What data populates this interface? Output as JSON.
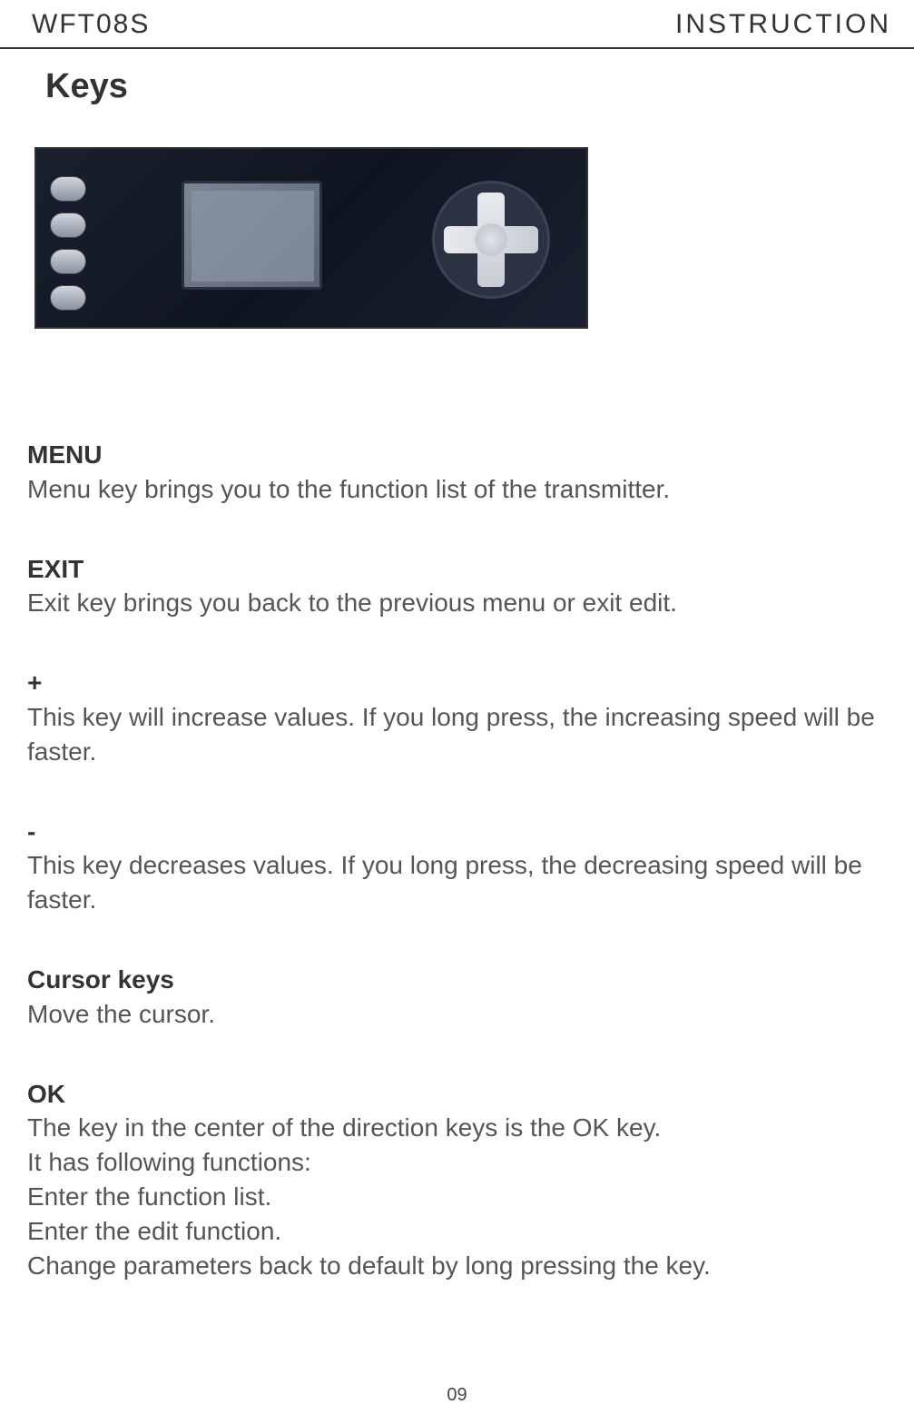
{
  "header": {
    "left": "WFT08S",
    "right": "INSTRUCTION"
  },
  "title": "Keys",
  "sections": {
    "menu": {
      "title": "MENU",
      "body": "Menu key brings you to the function list of the transmitter."
    },
    "exit": {
      "title": "EXIT",
      "body": "Exit key brings you back to the previous menu or exit edit."
    },
    "plus": {
      "title": "+",
      "body": "This key will increase values. If you long press, the increasing speed will be faster."
    },
    "minus": {
      "title": "-",
      "body": "This key decreases values. If you long press, the decreasing speed will be faster."
    },
    "cursor": {
      "title": "Cursor keys",
      "body": "Move the cursor."
    },
    "ok": {
      "title": "OK",
      "body_line1": "The key in the center of the direction keys is the OK key.",
      "body_line2": "It has following functions:",
      "body_line3": "Enter the function list.",
      "body_line4": "Enter the edit function.",
      "body_line5": "Change parameters back to default by long pressing the key."
    }
  },
  "page_number": "09"
}
